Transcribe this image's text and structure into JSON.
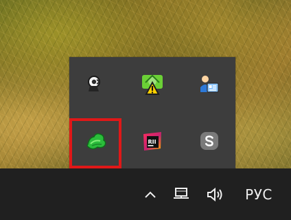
{
  "taskbar": {
    "language_label": "РУС"
  },
  "tray_popup": {
    "icons": [
      {
        "name": "speaker-icon"
      },
      {
        "name": "warning-icon"
      },
      {
        "name": "user-card-icon"
      },
      {
        "name": "green-cloud-icon",
        "highlighted": true
      },
      {
        "name": "rider-icon"
      },
      {
        "name": "skype-icon"
      }
    ]
  },
  "colors": {
    "popup_bg": "#3d3d3d",
    "taskbar_bg": "#202020",
    "highlight": "#e01818"
  }
}
